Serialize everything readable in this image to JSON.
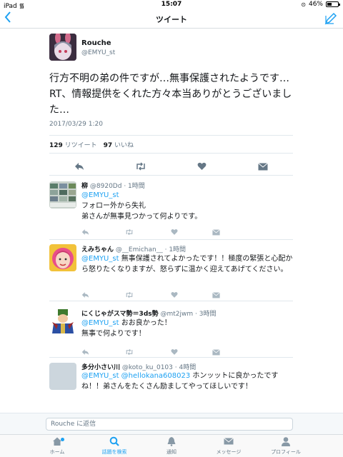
{
  "status": {
    "device": "iPad",
    "time": "15:07",
    "battery": "46%",
    "battery_level": 0.46
  },
  "nav": {
    "title": "ツイート"
  },
  "main_tweet": {
    "name": "Rouche",
    "handle": "@EMYU_st",
    "text": "行方不明の弟の件ですが…無事保護されたようです…RT、情報提供をくれた方々本当ありがとうございました…",
    "date": "2017/03/29 1:20",
    "retweet_count": "129",
    "retweet_label": "リツイート",
    "like_count": "97",
    "like_label": "いいね"
  },
  "replies": [
    {
      "name": "柳",
      "handle": "@8920Dd",
      "time": "· 1時間",
      "mentions": "@EMYU_st",
      "text": "フォロー外から失礼\n弟さんが無事見つかって何よりです。"
    },
    {
      "name": "えみちゃん",
      "handle": "@__Emichan__",
      "time": "· 1時間",
      "mentions": "@EMYU_st",
      "text": "無事保護されてよかったです！！極度の緊張と心配から怒りたくなりますが、怒らずに温かく迎えてあげてください。"
    },
    {
      "name": "にくじゃがスマ勢＝3ds勢",
      "handle": "@mt2jwm",
      "time": "· 3時間",
      "mentions": "@EMYU_st",
      "text": "おお良かった！\n無事で何よりです！"
    },
    {
      "name": "多分小さい川",
      "handle": "@koto_ku_0103",
      "time": "· 4時間",
      "mentions": "@EMYU_st @hellokana608023",
      "text": "ホンッットに良かったですね！！弟さんをたくさん励ましてやってほしいです！"
    }
  ],
  "reply_bar": {
    "placeholder": "Rouche に返信"
  },
  "tabs": [
    {
      "label": "ホーム",
      "icon": "home-icon"
    },
    {
      "label": "話題を検索",
      "icon": "search-icon"
    },
    {
      "label": "通知",
      "icon": "bell-icon"
    },
    {
      "label": "メッセージ",
      "icon": "envelope-icon"
    },
    {
      "label": "プロフィール",
      "icon": "person-icon"
    }
  ],
  "colors": {
    "accent": "#1da1f2",
    "secondary_text": "#657786",
    "divider": "#e1e8ed"
  }
}
